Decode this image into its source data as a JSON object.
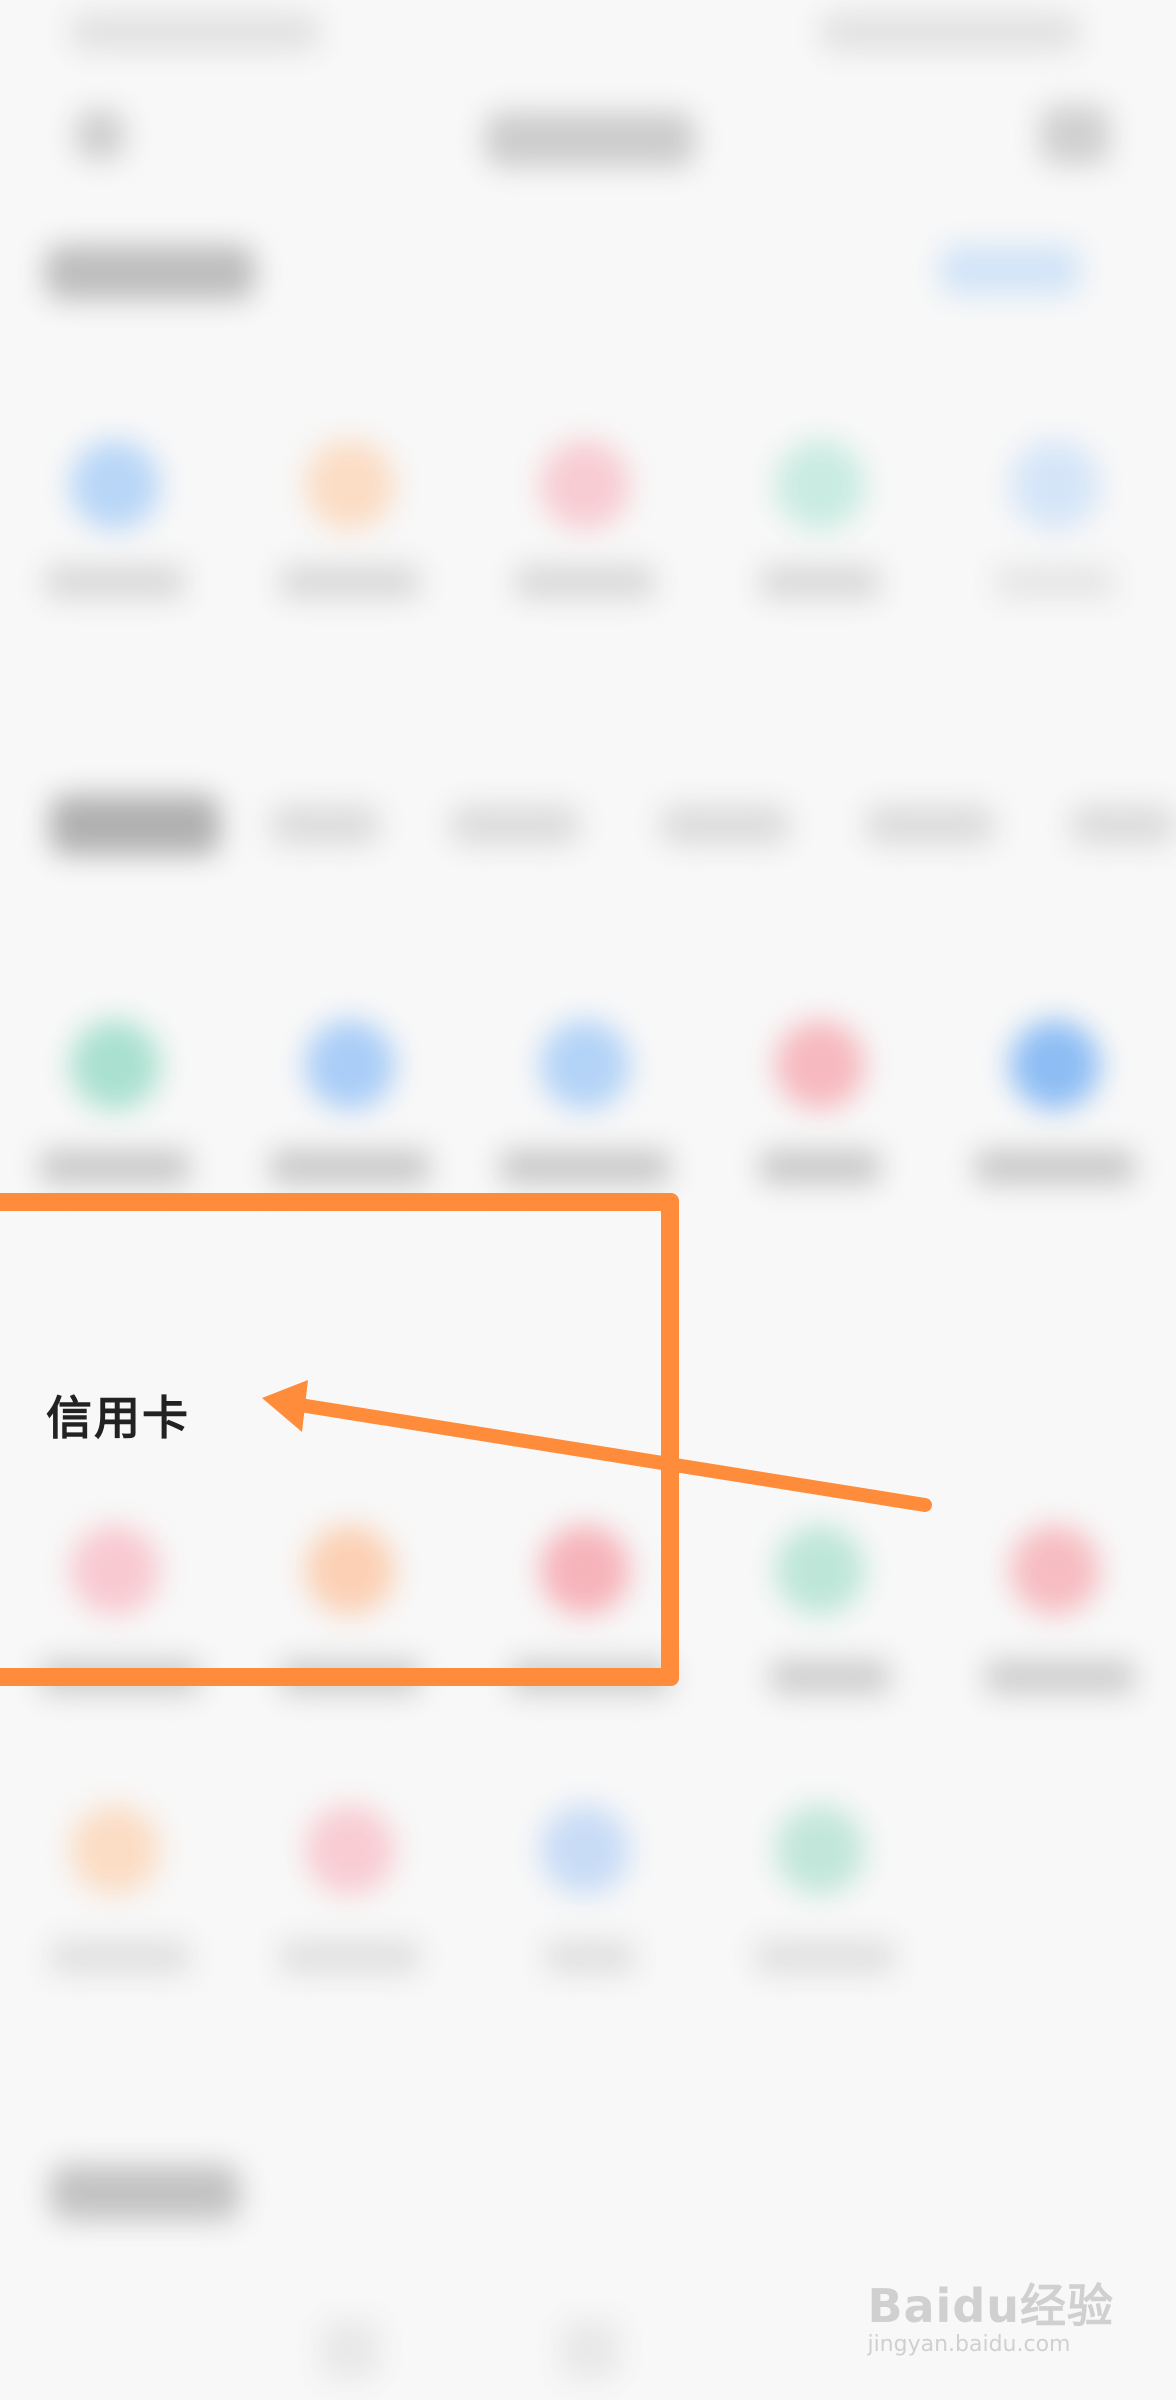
{
  "menu_item": {
    "label": "信用卡"
  },
  "watermark": {
    "logo_text": "Baidu经验",
    "url_text": "jingyan.baidu.com"
  },
  "colors": {
    "highlight": "#ff8c3a",
    "background": "#f8f8f8"
  }
}
